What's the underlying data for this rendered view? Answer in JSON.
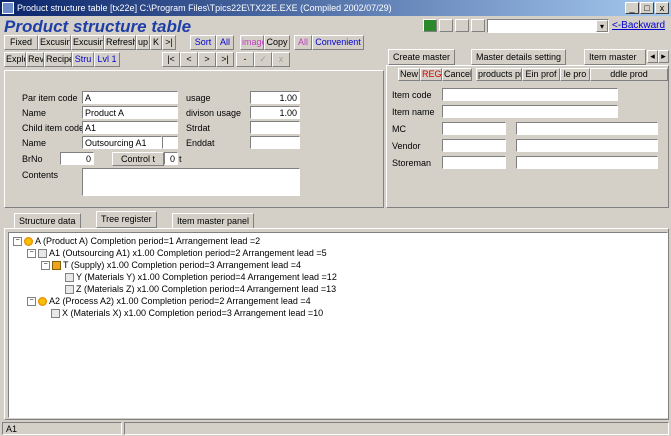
{
  "window": {
    "title": "Product structure table  [tx22e]  C:\\Program Files\\Tpics22E\\TX22E.EXE  (Compiled 2002/07/29)",
    "btn_min": "_",
    "btn_max": "□",
    "btn_close": "x"
  },
  "heading": "Product structure table",
  "toolbar_right": {
    "dropdown_value": "",
    "backward_link": "<-Backward"
  },
  "toolbar_row1": [
    "Fixed",
    "Excusin",
    "Excusin",
    "Refresh",
    "up",
    "K",
    ">|",
    "Sort",
    "All",
    "image",
    "Copy",
    "All",
    "Convenient"
  ],
  "toolbar_row2": [
    "Explor",
    "Rev",
    "Recipe",
    "Stru",
    "Lvl 1",
    "|<",
    "<",
    ">",
    ">|",
    "-",
    "✓",
    "x"
  ],
  "form": {
    "par_item_code_label": "Par item code",
    "par_item_code": "A",
    "name1_label": "Name",
    "name1": "Product A",
    "child_item_label": "Child item code",
    "child_item": "A1",
    "name2_label": "Name",
    "name2": "Outsourcing A1",
    "brno_label": "BrNo",
    "brno": "0",
    "control_label": "Control t",
    "control_value": "0",
    "control_suffix": "t",
    "contents_label": "Contents",
    "usage_label": "usage",
    "usage": "1.00",
    "division_label": "divison usage",
    "division": "1.00",
    "strdat_label": "Strdat",
    "enddat_label": "Enddat"
  },
  "right_tabs": [
    "Create master",
    "Master details setting",
    "Item master"
  ],
  "right_buttons": [
    "New",
    "REG",
    "Cancel",
    "products pr",
    "Ein prof",
    "le pro",
    "ddle prod"
  ],
  "right_form": {
    "item_code_label": "Item code",
    "item_name_label": "Item name",
    "mc_label": "MC",
    "vendor_label": "Vendor",
    "storeman_label": "Storeman"
  },
  "bottom_tabs": [
    "Structure data",
    "Tree register",
    "Item master panel"
  ],
  "tree": [
    {
      "text": "A (Product A)  Completion period=1 Arrangement lead =2",
      "icon": "star"
    },
    {
      "text": "A1 (Outsourcing A1) x1.00 Completion period=2 Arrangement lead =5",
      "icon": "doc"
    },
    {
      "text": "T (Supply) x1.00 Completion period=3 Arrangement lead =4",
      "icon": "supply"
    },
    {
      "text": "Y (Materials Y) x1.00 Completion period=4 Arrangement lead =12",
      "icon": "doc"
    },
    {
      "text": "Z (Materials Z) x1.00 Completion period=4 Arrangement lead =13",
      "icon": "doc"
    },
    {
      "text": "A2 (Process A2) x1.00 Completion period=2 Arrangement lead =4",
      "icon": "star"
    },
    {
      "text": "X (Materials X) x1.00 Completion period=3 Arrangement lead =10",
      "icon": "doc"
    }
  ],
  "status": {
    "left": "A1"
  }
}
